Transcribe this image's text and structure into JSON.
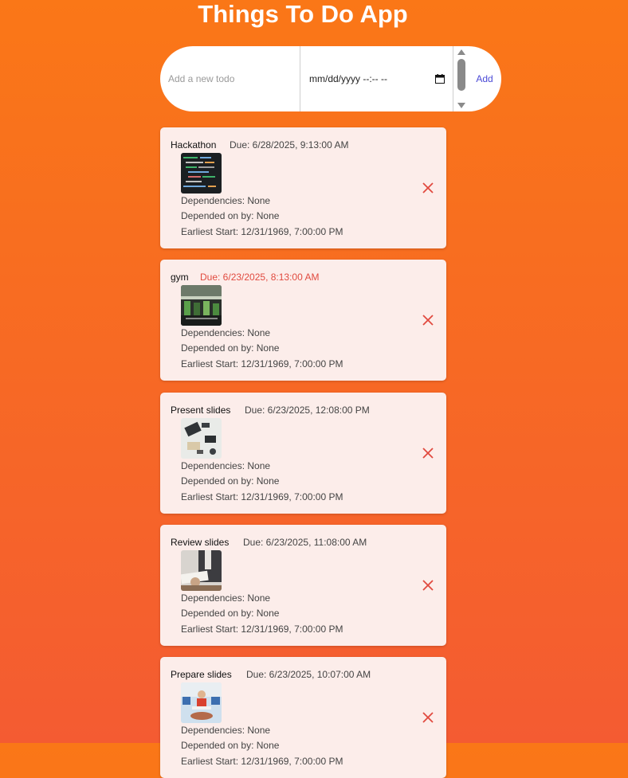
{
  "app": {
    "title": "Things To Do App"
  },
  "form": {
    "placeholder": "Add a new todo",
    "date_value": "mm/dd/yyyy --:-- --",
    "add_label": "Add"
  },
  "labels": {
    "dependencies": "Dependencies: None",
    "depended_on_by": "Depended on by: None",
    "earliest_start": "Earliest Start: 12/31/1969, 7:00:00 PM"
  },
  "colors": {
    "overdue": "#e14a3f",
    "add": "#4b4ad6",
    "delete": "#e14a3f"
  },
  "todos": [
    {
      "title": "Hackathon",
      "due": "Due: 6/28/2025, 9:13:00 AM",
      "overdue": false
    },
    {
      "title": "gym",
      "due": "Due: 6/23/2025, 8:13:00 AM",
      "overdue": true
    },
    {
      "title": "Present slides",
      "due": "Due: 6/23/2025, 12:08:00 PM",
      "overdue": false
    },
    {
      "title": "Review slides",
      "due": "Due: 6/23/2025, 11:08:00 AM",
      "overdue": false
    },
    {
      "title": "Prepare slides",
      "due": "Due: 6/23/2025, 10:07:00 AM",
      "overdue": false
    }
  ]
}
